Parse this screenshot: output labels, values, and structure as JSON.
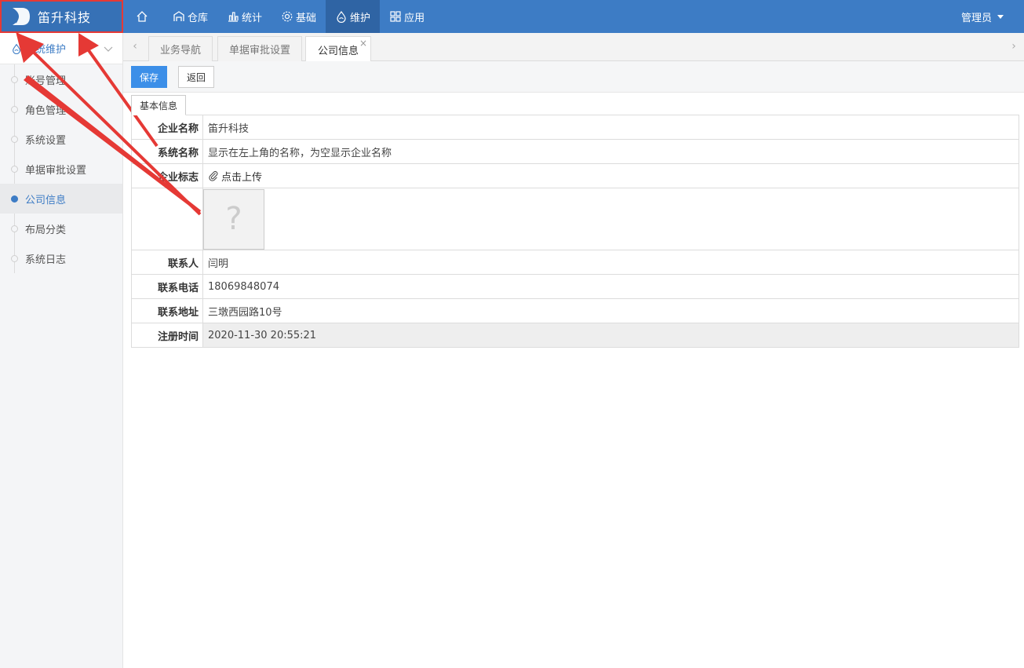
{
  "brand": {
    "name": "笛升科技"
  },
  "nav": {
    "items": [
      {
        "label": "",
        "icon": "home-icon"
      },
      {
        "label": "仓库",
        "icon": "warehouse-icon"
      },
      {
        "label": "统计",
        "icon": "bar-chart-icon"
      },
      {
        "label": "基础",
        "icon": "gear-icon"
      },
      {
        "label": "维护",
        "icon": "maintenance-icon",
        "active": true
      },
      {
        "label": "应用",
        "icon": "apps-grid-icon"
      }
    ],
    "user": "管理员"
  },
  "sidebar": {
    "header": "系统维护",
    "items": [
      {
        "label": "账号管理"
      },
      {
        "label": "角色管理"
      },
      {
        "label": "系统设置"
      },
      {
        "label": "单据审批设置"
      },
      {
        "label": "公司信息",
        "active": true
      },
      {
        "label": "布局分类"
      },
      {
        "label": "系统日志"
      }
    ]
  },
  "tabs": [
    {
      "label": "业务导航"
    },
    {
      "label": "单据审批设置"
    },
    {
      "label": "公司信息",
      "active": true,
      "close": "×"
    }
  ],
  "toolbar": {
    "save": "保存",
    "back": "返回"
  },
  "form": {
    "section": "基本信息",
    "company_name": {
      "label": "企业名称",
      "value": "笛升科技"
    },
    "system_name": {
      "label": "系统名称",
      "placeholder": "显示在左上角的名称，为空显示企业名称"
    },
    "logo": {
      "label": "企业标志",
      "upload": "点击上传",
      "image_placeholder": "?"
    },
    "contact": {
      "label": "联系人",
      "value": "闫明"
    },
    "phone": {
      "label": "联系电话",
      "value": "18069848074"
    },
    "address": {
      "label": "联系地址",
      "value": "三墩西园路10号"
    },
    "registered": {
      "label": "注册时间",
      "value": "2020-11-30 20:55:21"
    }
  },
  "colors": {
    "topbar": "#3d7cc5",
    "accent": "#3c8fe8",
    "highlight": "#e53935"
  }
}
